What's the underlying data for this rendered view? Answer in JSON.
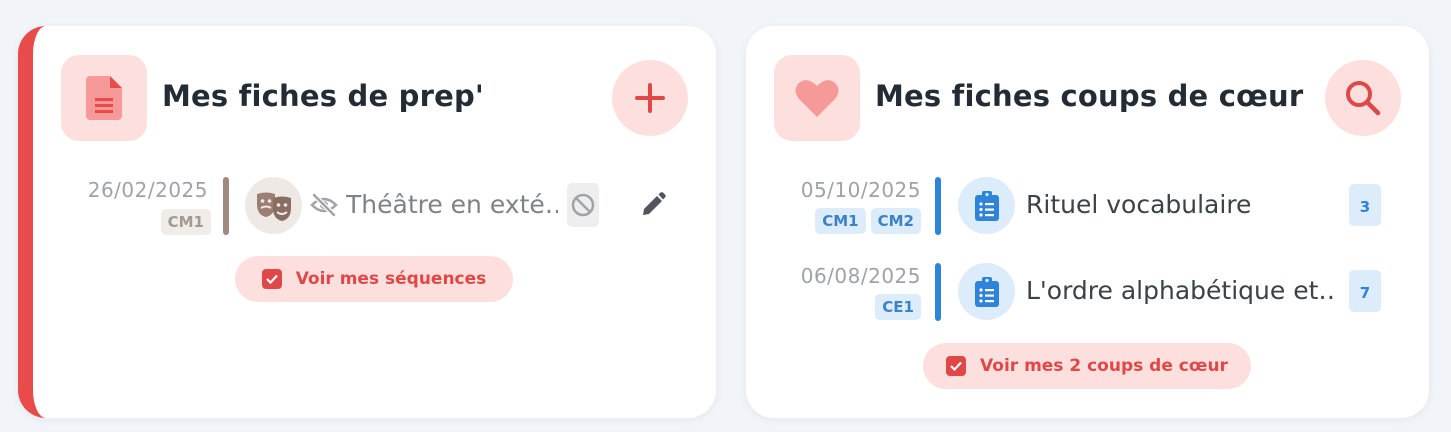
{
  "colors": {
    "accent_red": "#e94a4a",
    "soft_red": "#fde0de",
    "blue": "#2e84d8",
    "soft_blue": "#dcecfb",
    "brown_bar": "#a08a80"
  },
  "prep_card": {
    "title": "Mes fiches de prep'",
    "header_icon": "document-icon",
    "action_icon": "plus-icon",
    "items": [
      {
        "date": "26/02/2025",
        "tags": [
          "CM1"
        ],
        "avatar_icon": "theater-masks-icon",
        "hidden_icon": "eye-slash-icon",
        "title": "Théâtre en exté…",
        "status_icon": "ban-icon",
        "edit_icon": "pencil-icon"
      }
    ],
    "footer_button": "Voir mes séquences",
    "footer_icon": "checkbox-icon"
  },
  "fav_card": {
    "title": "Mes fiches coups de cœur",
    "header_icon": "heart-icon",
    "action_icon": "search-icon",
    "items": [
      {
        "date": "05/10/2025",
        "tags": [
          "CM1",
          "CM2"
        ],
        "avatar_icon": "clipboard-list-icon",
        "title": "Rituel vocabulaire",
        "count": "3"
      },
      {
        "date": "06/08/2025",
        "tags": [
          "CE1"
        ],
        "avatar_icon": "clipboard-list-icon",
        "title": "L'ordre alphabétique et…",
        "count": "7"
      }
    ],
    "footer_button": "Voir mes 2 coups de cœur",
    "footer_icon": "checkbox-icon"
  }
}
